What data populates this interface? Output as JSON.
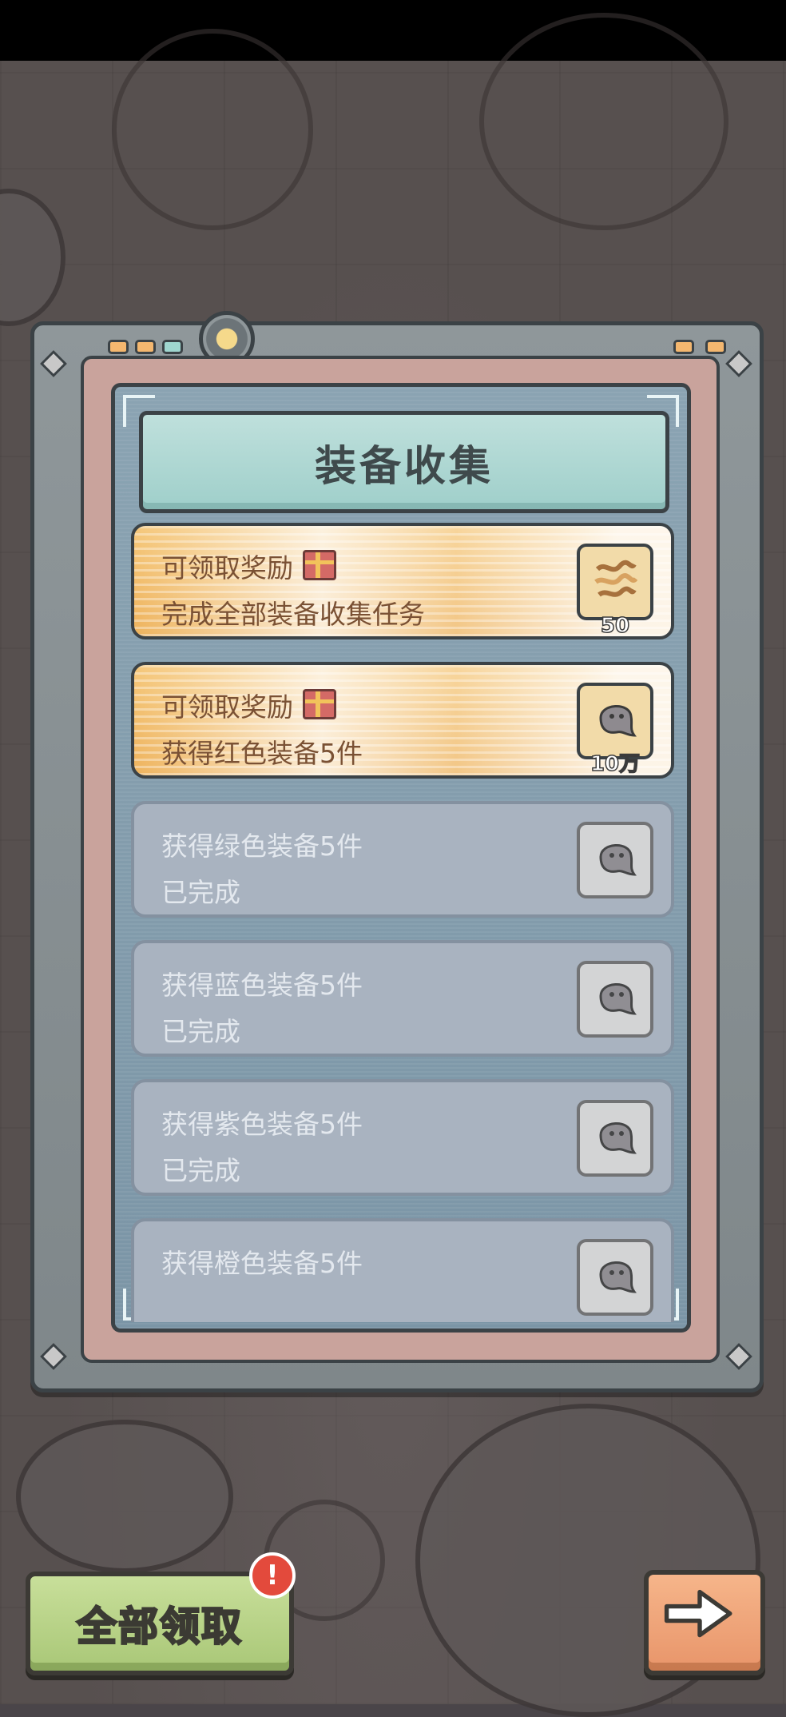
{
  "header": {
    "title": "装备收集"
  },
  "tasks": [
    {
      "line1": "可领取奖励",
      "line2": "完成全部装备收集任务",
      "reward_qty": "50",
      "reward_icon": "ribbon-scraps-icon",
      "state": "claimable"
    },
    {
      "line1": "可领取奖励",
      "line2": "获得红色装备5件",
      "reward_qty": "10万",
      "reward_icon": "slime-blob-icon",
      "state": "claimable"
    },
    {
      "line1": "获得绿色装备5件",
      "line2": "已完成",
      "reward_icon": "slime-blob-icon",
      "state": "completed"
    },
    {
      "line1": "获得蓝色装备5件",
      "line2": "已完成",
      "reward_icon": "slime-blob-icon",
      "state": "completed"
    },
    {
      "line1": "获得紫色装备5件",
      "line2": "已完成",
      "reward_icon": "slime-blob-icon",
      "state": "completed"
    },
    {
      "line1": "获得橙色装备5件",
      "reward_icon": "slime-blob-icon",
      "state": "completed"
    }
  ],
  "footer": {
    "claim_all_label": "全部领取",
    "badge": "!"
  },
  "colors": {
    "claimable": "#eeb35d",
    "completed": "#a9b3c0",
    "claim_button": "#a9c777",
    "next_button": "#e8956a"
  }
}
